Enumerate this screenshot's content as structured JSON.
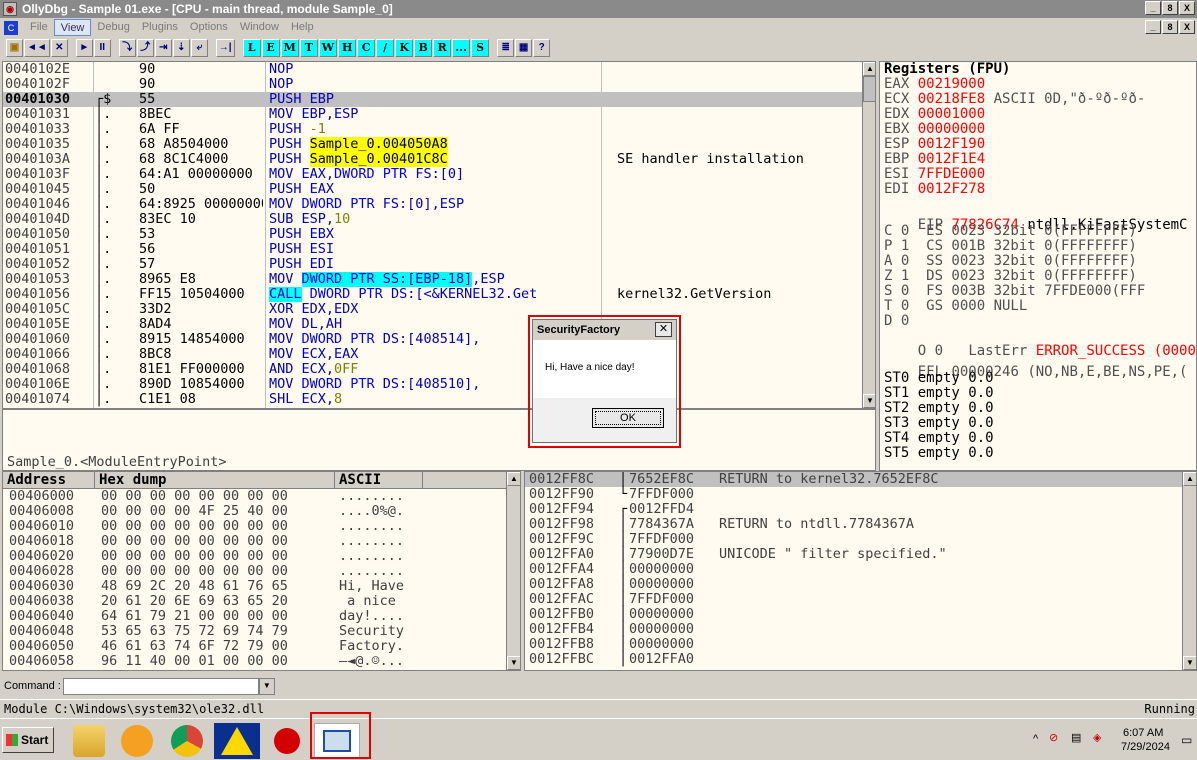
{
  "window": {
    "title": "OllyDbg - Sample 01.exe - [CPU - main thread, module Sample_0]",
    "buttons": [
      "_",
      "8",
      "X"
    ],
    "mdi_buttons": [
      "_",
      "8",
      "X"
    ]
  },
  "menu": [
    "File",
    "View",
    "Debug",
    "Plugins",
    "Options",
    "Window",
    "Help"
  ],
  "menu_active": "View",
  "toolbar": {
    "nav": [
      "◄◄",
      "✕",
      "►",
      "II",
      "⤵",
      "⤴",
      "⇥",
      "⇣",
      "⤶",
      "→|"
    ],
    "letters": [
      "L",
      "E",
      "M",
      "T",
      "W",
      "H",
      "C",
      "/",
      "K",
      "B",
      "R",
      "...",
      "S"
    ],
    "extra": [
      "≣",
      "▦",
      "?"
    ]
  },
  "cpu": {
    "rows": [
      {
        "addr": "0040102E",
        "mark": "",
        "hex": "90",
        "dis": "NOP",
        "com": ""
      },
      {
        "addr": "0040102F",
        "mark": "",
        "hex": "90",
        "dis": "NOP",
        "com": ""
      },
      {
        "addr": "00401030",
        "mark": "┌$",
        "hex": "55",
        "dis": "PUSH EBP",
        "com": "",
        "cur": true
      },
      {
        "addr": "00401031",
        "mark": "│.",
        "hex": "8BEC",
        "dis": "MOV EBP,ESP",
        "com": ""
      },
      {
        "addr": "00401033",
        "mark": "│.",
        "hex": "6A FF",
        "dis": "PUSH -1",
        "com": ""
      },
      {
        "addr": "00401035",
        "mark": "│.",
        "hex": "68 A8504000",
        "dis": "PUSH Sample_0.004050A8",
        "com": ""
      },
      {
        "addr": "0040103A",
        "mark": "│.",
        "hex": "68 8C1C4000",
        "dis": "PUSH Sample_0.00401C8C",
        "com": "SE handler installation"
      },
      {
        "addr": "0040103F",
        "mark": "│.",
        "hex": "64:A1 00000000",
        "dis": "MOV EAX,DWORD PTR FS:[0]",
        "com": ""
      },
      {
        "addr": "00401045",
        "mark": "│.",
        "hex": "50",
        "dis": "PUSH EAX",
        "com": ""
      },
      {
        "addr": "00401046",
        "mark": "│.",
        "hex": "64:8925 00000000",
        "dis": "MOV DWORD PTR FS:[0],ESP",
        "com": ""
      },
      {
        "addr": "0040104D",
        "mark": "│.",
        "hex": "83EC 10",
        "dis": "SUB ESP,10",
        "com": ""
      },
      {
        "addr": "00401050",
        "mark": "│.",
        "hex": "53",
        "dis": "PUSH EBX",
        "com": ""
      },
      {
        "addr": "00401051",
        "mark": "│.",
        "hex": "56",
        "dis": "PUSH ESI",
        "com": ""
      },
      {
        "addr": "00401052",
        "mark": "│.",
        "hex": "57",
        "dis": "PUSH EDI",
        "com": ""
      },
      {
        "addr": "00401053",
        "mark": "│.",
        "hex": "8965 E8",
        "dis": "MOV DWORD PTR SS:[EBP-18],ESP",
        "com": ""
      },
      {
        "addr": "00401056",
        "mark": "│.",
        "hex": "FF15 10504000",
        "dis": "CALL DWORD PTR DS:[<&KERNEL32.Get",
        "com": "kernel32.GetVersion"
      },
      {
        "addr": "0040105C",
        "mark": "│.",
        "hex": "33D2",
        "dis": "XOR EDX,EDX",
        "com": ""
      },
      {
        "addr": "0040105E",
        "mark": "│.",
        "hex": "8AD4",
        "dis": "MOV DL,AH",
        "com": ""
      },
      {
        "addr": "00401060",
        "mark": "│.",
        "hex": "8915 14854000",
        "dis": "MOV DWORD PTR DS:[408514],",
        "com": ""
      },
      {
        "addr": "00401066",
        "mark": "│.",
        "hex": "8BC8",
        "dis": "MOV ECX,EAX",
        "com": ""
      },
      {
        "addr": "00401068",
        "mark": "│.",
        "hex": "81E1 FF000000",
        "dis": "AND ECX,0FF",
        "com": ""
      },
      {
        "addr": "0040106E",
        "mark": "│.",
        "hex": "890D 10854000",
        "dis": "MOV DWORD PTR DS:[408510],",
        "com": ""
      },
      {
        "addr": "00401074",
        "mark": "│.",
        "hex": "C1E1 08",
        "dis": "SHL ECX,8",
        "com": ""
      }
    ],
    "info": "Sample_0.<ModuleEntryPoint>"
  },
  "registers": {
    "title": "Registers (FPU)",
    "gp": [
      {
        "name": "EAX",
        "val": "00219000",
        "note": ""
      },
      {
        "name": "ECX",
        "val": "00218FE8",
        "note": "ASCII 0D,\"ð-ºð-ºð-"
      },
      {
        "name": "EDX",
        "val": "00001000",
        "note": ""
      },
      {
        "name": "EBX",
        "val": "00000000",
        "note": ""
      },
      {
        "name": "ESP",
        "val": "0012F190",
        "note": ""
      },
      {
        "name": "EBP",
        "val": "0012F1E4",
        "note": ""
      },
      {
        "name": "ESI",
        "val": "7FFDE000",
        "note": ""
      },
      {
        "name": "EDI",
        "val": "0012F278",
        "note": ""
      }
    ],
    "eip": {
      "name": "EIP",
      "val": "77826C74",
      "note": "ntdll.KiFastSystemC"
    },
    "flags": [
      "C 0  ES 0023 32bit 0(FFFFFFFF)",
      "P 1  CS 001B 32bit 0(FFFFFFFF)",
      "A 0  SS 0023 32bit 0(FFFFFFFF)",
      "Z 1  DS 0023 32bit 0(FFFFFFFF)",
      "S 0  FS 003B 32bit 7FFDE000(FFF",
      "T 0  GS 0000 NULL",
      "D 0"
    ],
    "lasterr": {
      "flag": "O 0",
      "label": "LastErr",
      "val": "ERROR_SUCCESS (0000"
    },
    "efl": {
      "label": "EFL",
      "val": "00000246",
      "note": "(NO,NB,E,BE,NS,PE,("
    },
    "st": [
      "ST0 empty 0.0",
      "ST1 empty 0.0",
      "ST2 empty 0.0",
      "ST3 empty 0.0",
      "ST4 empty 0.0",
      "ST5 empty 0.0"
    ]
  },
  "dump": {
    "headers": [
      "Address",
      "Hex dump",
      "ASCII"
    ],
    "rows": [
      {
        "addr": "00406000",
        "hex": "00 00 00 00 00 00 00 00",
        "ascii": "........"
      },
      {
        "addr": "00406008",
        "hex": "00 00 00 00 4F 25 40 00",
        "ascii": "....0%@."
      },
      {
        "addr": "00406010",
        "hex": "00 00 00 00 00 00 00 00",
        "ascii": "........"
      },
      {
        "addr": "00406018",
        "hex": "00 00 00 00 00 00 00 00",
        "ascii": "........"
      },
      {
        "addr": "00406020",
        "hex": "00 00 00 00 00 00 00 00",
        "ascii": "........"
      },
      {
        "addr": "00406028",
        "hex": "00 00 00 00 00 00 00 00",
        "ascii": "........"
      },
      {
        "addr": "00406030",
        "hex": "48 69 2C 20 48 61 76 65",
        "ascii": "Hi, Have"
      },
      {
        "addr": "00406038",
        "hex": "20 61 20 6E 69 63 65 20",
        "ascii": " a nice "
      },
      {
        "addr": "00406040",
        "hex": "64 61 79 21 00 00 00 00",
        "ascii": "day!...."
      },
      {
        "addr": "00406048",
        "hex": "53 65 63 75 72 69 74 79",
        "ascii": "Security"
      },
      {
        "addr": "00406050",
        "hex": "46 61 63 74 6F 72 79 00",
        "ascii": "Factory."
      },
      {
        "addr": "00406058",
        "hex": "96 11 40 00 01 00 00 00",
        "ascii": "–◄@.☺..."
      }
    ]
  },
  "stack": {
    "rows": [
      {
        "addr": "0012FF8C",
        "mark": "│",
        "val": "7652EF8C",
        "com": "RETURN to kernel32.7652EF8C",
        "cur": true
      },
      {
        "addr": "0012FF90",
        "mark": "└",
        "val": "7FFDF000",
        "com": ""
      },
      {
        "addr": "0012FF94",
        "mark": "┌",
        "val": "0012FFD4",
        "com": ""
      },
      {
        "addr": "0012FF98",
        "mark": "│",
        "val": "7784367A",
        "com": "RETURN to ntdll.7784367A"
      },
      {
        "addr": "0012FF9C",
        "mark": "│",
        "val": "7FFDF000",
        "com": ""
      },
      {
        "addr": "0012FFA0",
        "mark": "│",
        "val": "77900D7E",
        "com": "UNICODE \" filter specified.\""
      },
      {
        "addr": "0012FFA4",
        "mark": "│",
        "val": "00000000",
        "com": ""
      },
      {
        "addr": "0012FFA8",
        "mark": "│",
        "val": "00000000",
        "com": ""
      },
      {
        "addr": "0012FFAC",
        "mark": "│",
        "val": "7FFDF000",
        "com": ""
      },
      {
        "addr": "0012FFB0",
        "mark": "│",
        "val": "00000000",
        "com": ""
      },
      {
        "addr": "0012FFB4",
        "mark": "│",
        "val": "00000000",
        "com": ""
      },
      {
        "addr": "0012FFB8",
        "mark": "│",
        "val": "00000000",
        "com": ""
      },
      {
        "addr": "0012FFBC",
        "mark": "│",
        "val": "0012FFA0",
        "com": ""
      }
    ]
  },
  "command": {
    "label": "Command :",
    "value": ""
  },
  "status": {
    "left": "Module C:\\Windows\\system32\\ole32.dll",
    "right": "Running"
  },
  "dialog": {
    "title": "SecurityFactory",
    "message": "Hi, Have a nice day!",
    "ok": "OK",
    "close": "✕"
  },
  "taskbar": {
    "start": "Start",
    "apps": [
      "explorer-icon",
      "media-player-icon",
      "chrome-icon",
      "warning-icon",
      "ida-icon",
      "ollydbg-icon"
    ],
    "time": "6:07 AM",
    "date": "7/29/2024"
  },
  "colors": {
    "highlight_yellow": "#ffff00",
    "highlight_cyan": "#00ffff",
    "register_red": "#ff0000",
    "annotation_red": "#e00000"
  }
}
